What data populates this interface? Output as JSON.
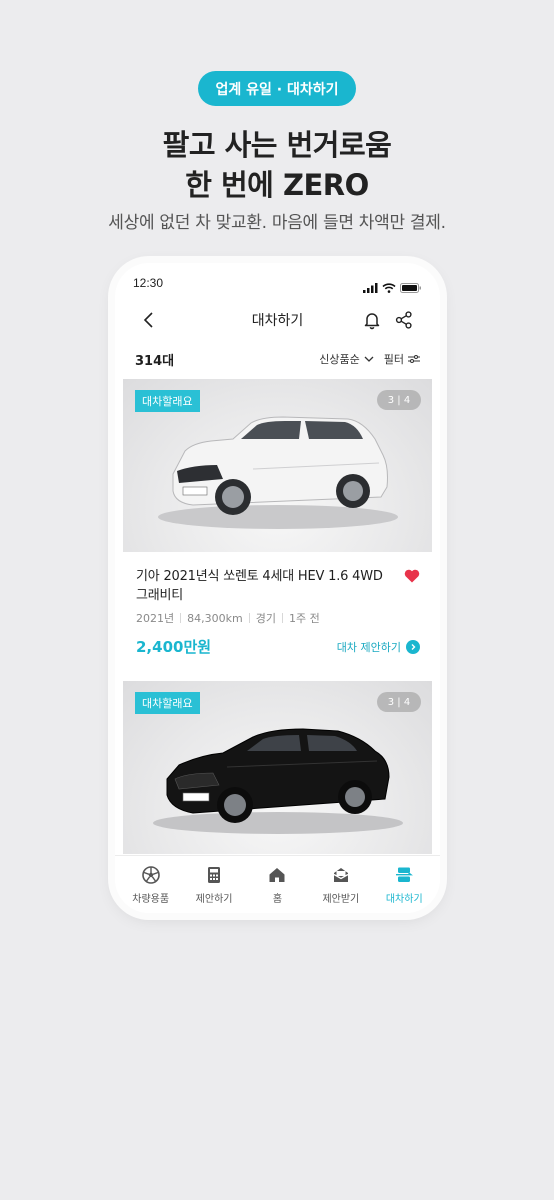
{
  "promo": {
    "badge": "업계 유일 · 대차하기",
    "headline_1": "팔고 사는 번거로움",
    "headline_2": "한 번에 ZERO",
    "subline": "세상에 없던 차 맞교환. 마음에 들면 차액만 결제."
  },
  "status_bar": {
    "time": "12:30"
  },
  "app_bar": {
    "title": "대차하기",
    "icons": [
      "back-icon",
      "bell-icon",
      "share-icon"
    ]
  },
  "list_header": {
    "count": "314대",
    "sort_label": "신상품순",
    "filter_label": "필터"
  },
  "listings": [
    {
      "tag": "대차할래요",
      "pager": "3 | 4",
      "title": "기아 2021년식 쏘렌토 4세대 HEV 1.6 4WD 그래비티",
      "year": "2021년",
      "mileage": "84,300km",
      "region": "경기",
      "posted": "1주 전",
      "price": "2,400만원",
      "action": "대차 제안하기",
      "liked": true,
      "car_color": "#f2f2f2"
    },
    {
      "tag": "대차할래요",
      "pager": "3 | 4",
      "car_color": "#151515"
    }
  ],
  "tab_bar": [
    {
      "label": "차량용품",
      "icon": "wheel-icon",
      "active": false
    },
    {
      "label": "제안하기",
      "icon": "calculator-icon",
      "active": false
    },
    {
      "label": "홈",
      "icon": "home-icon",
      "active": false
    },
    {
      "label": "제안받기",
      "icon": "inbox-icon",
      "active": false
    },
    {
      "label": "대차하기",
      "icon": "exchange-icon",
      "active": true
    }
  ],
  "colors": {
    "accent": "#1ab6cf",
    "heart": "#e8334a",
    "background": "#ececee"
  }
}
